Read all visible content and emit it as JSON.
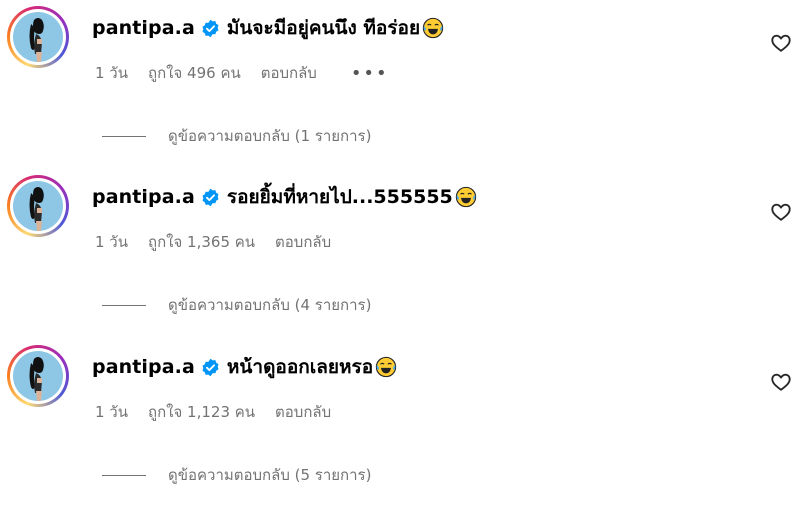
{
  "comments": [
    {
      "username": "pantipa.a",
      "text": "มันจะมีอยู่คนนึง ทีอร่อย",
      "time": "1 วัน",
      "likes": "ถูกใจ 496 คน",
      "reply": "ตอบกลับ",
      "more": "•••",
      "view_replies": "ดูข้อความตอบกลับ (1 รายการ)"
    },
    {
      "username": "pantipa.a",
      "text": "รอยยิ้มที่หายไป...555555",
      "time": "1 วัน",
      "likes": "ถูกใจ 1,365 คน",
      "reply": "ตอบกลับ",
      "view_replies": "ดูข้อความตอบกลับ (4 รายการ)"
    },
    {
      "username": "pantipa.a",
      "text": "หน้าดูออกเลยหรอ",
      "time": "1 วัน",
      "likes": "ถูกใจ 1,123 คน",
      "reply": "ตอบกลับ",
      "view_replies": "ดูข้อความตอบกลับ (5 รายการ)"
    }
  ],
  "icons": {
    "verified": "verified-badge-icon",
    "emoji": "laughing-tears-emoji-icon",
    "like": "heart-outline-icon"
  },
  "colors": {
    "verified": "#0095f6",
    "meta": "#737373",
    "avatar_bg": "#8ec7e6"
  }
}
